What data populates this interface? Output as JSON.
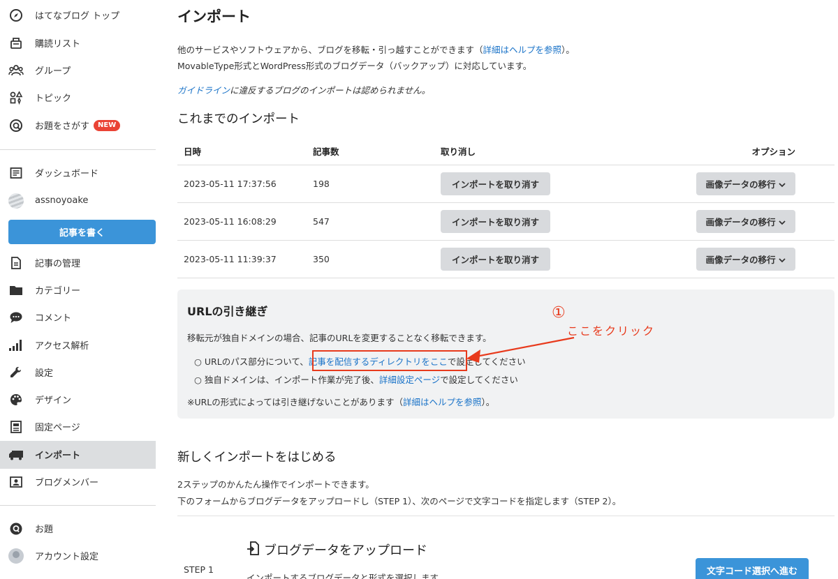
{
  "sidebar": {
    "top_items": [
      {
        "label": "はてなブログ トップ",
        "icon": "compass-icon"
      },
      {
        "label": "購読リスト",
        "icon": "reading-list-icon"
      },
      {
        "label": "グループ",
        "icon": "group-icon"
      },
      {
        "label": "トピック",
        "icon": "topic-icon"
      },
      {
        "label": "お題をさがす",
        "icon": "theme-search-icon",
        "badge": "NEW"
      }
    ],
    "dashboard": {
      "label": "ダッシュボード",
      "icon": "dashboard-icon"
    },
    "user": {
      "label": "assnoyoake"
    },
    "write_button": "記事を書く",
    "blog_items": [
      {
        "label": "記事の管理",
        "icon": "document-icon"
      },
      {
        "label": "カテゴリー",
        "icon": "folder-icon"
      },
      {
        "label": "コメント",
        "icon": "comment-icon"
      },
      {
        "label": "アクセス解析",
        "icon": "bar-chart-icon"
      },
      {
        "label": "設定",
        "icon": "wrench-icon"
      },
      {
        "label": "デザイン",
        "icon": "palette-icon"
      },
      {
        "label": "固定ページ",
        "icon": "page-icon"
      },
      {
        "label": "インポート",
        "icon": "truck-icon",
        "active": true
      },
      {
        "label": "ブログメンバー",
        "icon": "member-icon"
      }
    ],
    "bottom_items": [
      {
        "label": "お題",
        "icon": "theme-icon"
      },
      {
        "label": "アカウント設定",
        "icon": "account-avatar"
      }
    ]
  },
  "main": {
    "title": "インポート",
    "intro_line1_a": "他のサービスやソフトウェアから、ブログを移転・引っ越すことができます（",
    "intro_line1_link": "詳細はヘルプを参照",
    "intro_line1_b": "）。",
    "intro_line2": "MovableType形式とWordPress形式のブログデータ（バックアップ）に対応しています。",
    "guideline_link": "ガイドライン",
    "guideline_text": "に違反するブログのインポートは認められません。",
    "history_heading": "これまでのインポート",
    "table": {
      "headers": [
        "日時",
        "記事数",
        "取り消し",
        "オプション"
      ],
      "rows": [
        {
          "date": "2023-05-11 17:37:56",
          "count": "198"
        },
        {
          "date": "2023-05-11 16:08:29",
          "count": "547"
        },
        {
          "date": "2023-05-11 11:39:37",
          "count": "350"
        }
      ],
      "cancel_label": "インポートを取り消す",
      "option_label": "画像データの移行"
    },
    "url_panel": {
      "title": "URLの引き継ぎ",
      "desc": "移転元が独自ドメインの場合、記事のURLを変更することなく移転できます。",
      "bullet1_a": "URLのパス部分について、",
      "bullet1_link": "記事を配信するディレクトリをここ",
      "bullet1_b": "で設定してください",
      "bullet2_a": "独自ドメインは、インポート作業が完了後、",
      "bullet2_link": "詳細設定ページ",
      "bullet2_b": "で設定してください",
      "note_a": "※URLの形式によっては引き継げないことがあります（",
      "note_link": "詳細はヘルプを参照",
      "note_b": "）。"
    },
    "new_heading": "新しくインポートをはじめる",
    "new_line1": "2ステップのかんたん操作でインポートできます。",
    "new_line2": "下のフォームからブログデータをアップロードし（STEP 1）、次のページで文字コードを指定します（STEP 2）。",
    "step_label": "STEP 1",
    "upload_title": "ブログデータをアップロード",
    "upload_desc": "インポートするブログデータと形式を選択します。",
    "next_button": "文字コード選択へ進む"
  },
  "annotation": {
    "number": "①",
    "text": "ここをクリック",
    "color": "#e83a1c"
  }
}
